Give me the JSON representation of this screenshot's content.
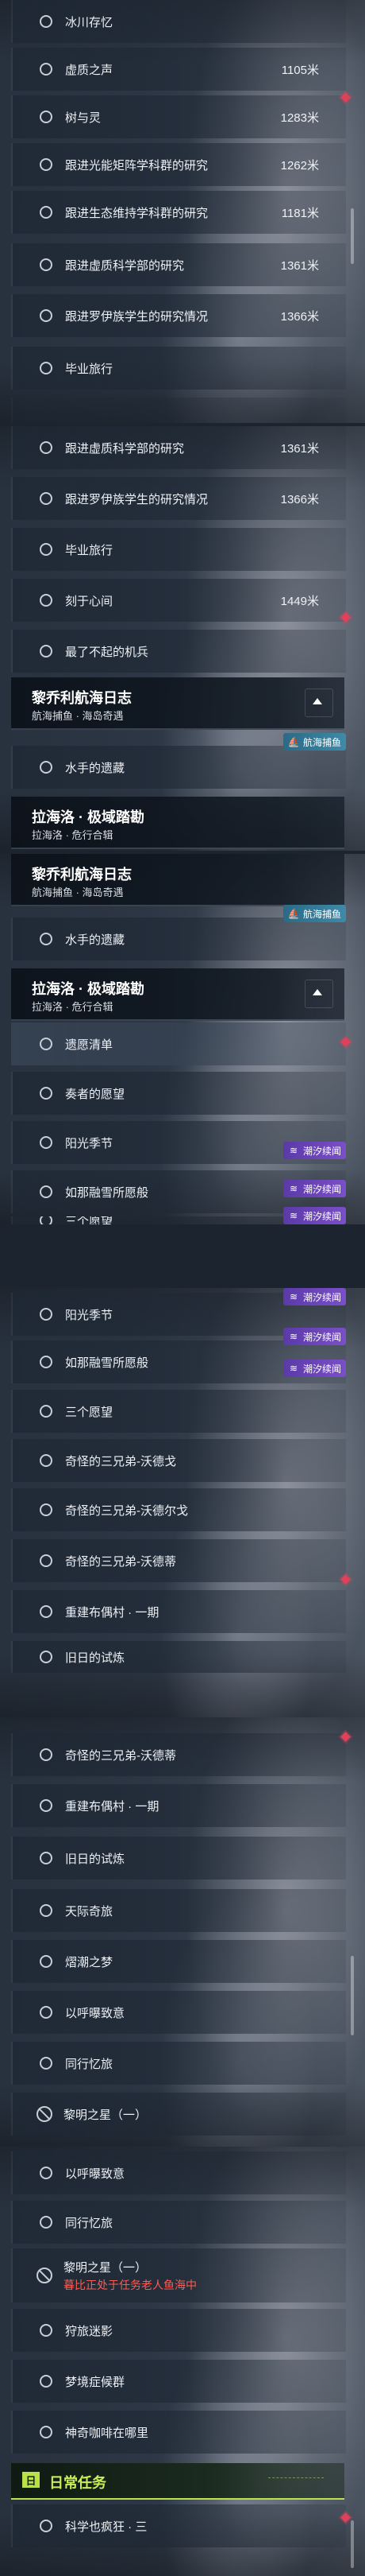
{
  "panels": [
    {
      "rows": [
        {
          "label": "冰川存忆",
          "dist": "",
          "icon": "circle"
        },
        {
          "label": "虚质之声",
          "dist": "1105米",
          "icon": "circle"
        },
        {
          "label": "树与灵",
          "dist": "1283米",
          "icon": "circle"
        },
        {
          "label": "跟进光能矩阵学科群的研究",
          "dist": "1262米",
          "icon": "circle"
        },
        {
          "label": "跟进生态维持学科群的研究",
          "dist": "1181米",
          "icon": "circle"
        },
        {
          "label": "跟进虚质科学部的研究",
          "dist": "1361米",
          "icon": "circle"
        },
        {
          "label": "跟进罗伊族学生的研究情况",
          "dist": "1366米",
          "icon": "circle"
        },
        {
          "label": "毕业旅行",
          "dist": "",
          "icon": "circle"
        }
      ]
    },
    {
      "rows": [
        {
          "label": "跟进虚质科学部的研究",
          "dist": "1361米",
          "icon": "circle"
        },
        {
          "label": "跟进罗伊族学生的研究情况",
          "dist": "1366米",
          "icon": "circle"
        },
        {
          "label": "毕业旅行",
          "dist": "",
          "icon": "circle"
        },
        {
          "label": "刻于心间",
          "dist": "1449米",
          "icon": "circle"
        },
        {
          "label": "最了不起的机兵",
          "dist": "",
          "icon": "circle"
        }
      ],
      "header": {
        "title": "黎乔利航海日志",
        "subtitle": "航海捕鱼 · 海岛奇遇"
      },
      "rows_after": [
        {
          "label": "水手的遗藏",
          "dist": "",
          "icon": "circle"
        }
      ],
      "header2": {
        "title": "拉海洛 · 极域踏勘",
        "subtitle": "拉海洛 · 危行合辑"
      }
    },
    {
      "header": {
        "title": "黎乔利航海日志",
        "subtitle": "航海捕鱼 · 海岛奇遇"
      },
      "rows": [
        {
          "label": "水手的遗藏",
          "dist": "",
          "icon": "circle"
        }
      ],
      "header2": {
        "title": "拉海洛 · 极域踏勘",
        "subtitle": "拉海洛 · 危行合辑"
      },
      "rows_after": [
        {
          "label": "遗愿清单",
          "dist": "",
          "icon": "circle"
        },
        {
          "label": "奏者的愿望",
          "dist": "",
          "icon": "circle"
        },
        {
          "label": "阳光季节",
          "dist": "",
          "icon": "circle"
        },
        {
          "label": "如那融雪所愿般",
          "dist": "",
          "icon": "circle"
        },
        {
          "label": "三个愿望",
          "dist": "",
          "icon": "circle"
        }
      ]
    },
    {
      "rows": [
        {
          "label": "阳光季节",
          "dist": "",
          "icon": "circle"
        },
        {
          "label": "如那融雪所愿般",
          "dist": "",
          "icon": "circle"
        },
        {
          "label": "三个愿望",
          "dist": "",
          "icon": "circle"
        },
        {
          "label": "奇怪的三兄弟-沃德戈",
          "dist": "",
          "icon": "circle"
        },
        {
          "label": "奇怪的三兄弟-沃德尔戈",
          "dist": "",
          "icon": "circle"
        },
        {
          "label": "奇怪的三兄弟-沃德蒂",
          "dist": "",
          "icon": "circle"
        },
        {
          "label": "重建布偶村 · 一期",
          "dist": "",
          "icon": "circle"
        },
        {
          "label": "旧日的试炼",
          "dist": "",
          "icon": "circle"
        }
      ]
    },
    {
      "rows": [
        {
          "label": "奇怪的三兄弟-沃德蒂",
          "dist": "",
          "icon": "circle"
        },
        {
          "label": "重建布偶村 · 一期",
          "dist": "",
          "icon": "circle"
        },
        {
          "label": "旧日的试炼",
          "dist": "",
          "icon": "circle"
        },
        {
          "label": "天际奇旅",
          "dist": "",
          "icon": "circle"
        },
        {
          "label": "熠潮之梦",
          "dist": "",
          "icon": "circle"
        },
        {
          "label": "以呼曝致意",
          "dist": "",
          "icon": "circle"
        },
        {
          "label": "同行忆旅",
          "dist": "",
          "icon": "circle"
        },
        {
          "label": "黎明之星（一）",
          "dist": "",
          "icon": "ban"
        }
      ]
    },
    {
      "rows": [
        {
          "label": "以呼曝致意",
          "dist": "",
          "icon": "circle"
        },
        {
          "label": "同行忆旅",
          "dist": "",
          "icon": "circle"
        },
        {
          "label": "黎明之星（一）",
          "dist": "",
          "icon": "ban",
          "sub": "暮比正处于任务老人鱼海中"
        },
        {
          "label": "狩旅迷影",
          "dist": "",
          "icon": "circle"
        },
        {
          "label": "梦境症候群",
          "dist": "",
          "icon": "circle"
        },
        {
          "label": "神奇咖啡在哪里",
          "dist": "",
          "icon": "circle"
        }
      ],
      "daily": {
        "badge": "日",
        "title": "日常任务"
      },
      "rows_after": [
        {
          "label": "科学也疯狂 · 三",
          "dist": "",
          "icon": "circle"
        }
      ]
    }
  ],
  "badges": {
    "chaoxi": "潮汐续闻",
    "hanghai": "航海捕鱼"
  },
  "colors": {
    "purple_badge": "#6a45b8",
    "teal_badge": "#357a98",
    "track_marker": "#e0405a",
    "daily_accent": "#b9e24a"
  }
}
